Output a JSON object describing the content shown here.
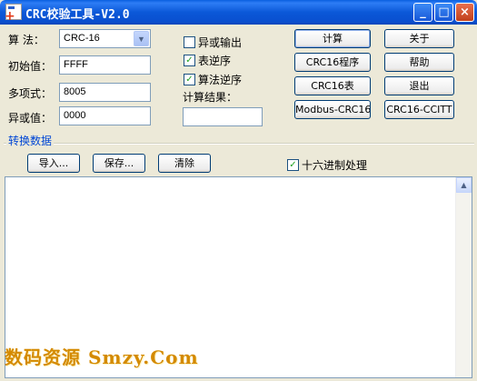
{
  "window": {
    "title": "CRC校验工具-V2.0",
    "controls": {
      "minimize": "_",
      "maximize": "□",
      "close": "×"
    }
  },
  "params": {
    "algorithm_label": "算  法：",
    "algorithm_value": "CRC-16",
    "init_label": "初始值：",
    "init_value": "FFFF",
    "poly_label": "多项式：",
    "poly_value": "8005",
    "xor_label": "异或值：",
    "xor_value": "0000"
  },
  "options": [
    {
      "label": "异或输出",
      "checked": false
    },
    {
      "label": "表逆序",
      "checked": true
    },
    {
      "label": "算法逆序",
      "checked": true
    }
  ],
  "result": {
    "label": "计算结果：",
    "value": ""
  },
  "buttons": {
    "calculate": "计算",
    "about": "关于",
    "crc16_program": "CRC16程序",
    "help": "帮助",
    "crc16_table": "CRC16表",
    "exit": "退出",
    "modbus_crc16": "Modbus-CRC16",
    "crc16_ccitt": "CRC16-CCITT"
  },
  "data_section": {
    "title": "转换数据",
    "import": "导入...",
    "save": "保存...",
    "clear": "清除",
    "hex_option": {
      "label": "十六进制处理",
      "checked": true
    },
    "content": ""
  },
  "watermark": "数码资源 Smzy.Com",
  "icons": {
    "check": "✓",
    "dropdown": "▼",
    "scroll_up": "▲"
  }
}
